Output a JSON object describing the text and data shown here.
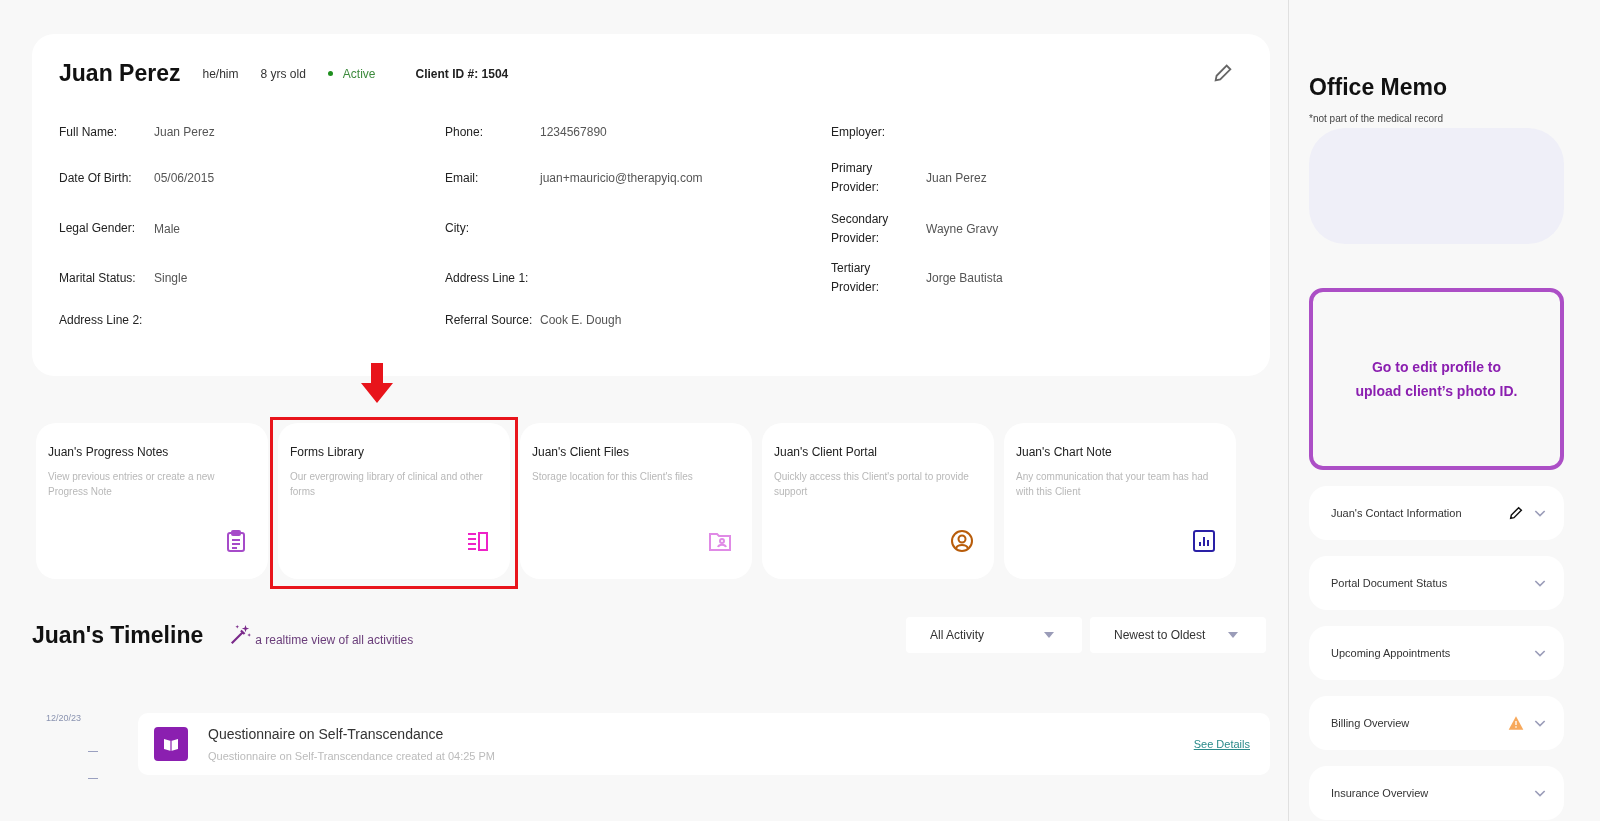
{
  "client": {
    "name": "Juan Perez",
    "pronouns": "he/him",
    "age": "8 yrs old",
    "status": "Active",
    "active": true,
    "client_id_label": "Client ID #:",
    "client_id": "1504"
  },
  "fields": [
    [
      {
        "label": "Full Name:",
        "value": "Juan Perez"
      },
      {
        "label": "Phone:",
        "value": "1234567890"
      },
      {
        "label": "Employer:"
      }
    ],
    [
      {
        "label": "Date Of Birth:",
        "value": "05/06/2015"
      },
      {
        "label": "Email:",
        "value": "juan+mauricio@therapyiq.com"
      },
      {
        "label": "Primary Provider:",
        "value": "Juan Perez"
      }
    ],
    [
      {
        "label": "Legal Gender:",
        "value": "Male"
      },
      {
        "label": "City:"
      },
      {
        "label": "Secondary Provider:",
        "value": "Wayne Gravy"
      }
    ],
    [
      {
        "label": "Marital Status:",
        "value": "Single"
      },
      {
        "label": "Address Line 1:"
      },
      {
        "label": "Tertiary Provider:",
        "value": "Jorge Bautista"
      }
    ],
    [
      {
        "label": "Address Line 2:"
      },
      {
        "label": "Referral Source:",
        "value": "Cook E. Dough"
      }
    ]
  ],
  "tiles": [
    {
      "title": "Juan's Progress Notes",
      "description": "View previous entries or create a new Progress Note",
      "kind": "clipboard",
      "highlighted": false
    },
    {
      "title": "Forms Library",
      "description": "Our evergrowing library of clinical and other forms",
      "kind": "forms",
      "highlighted": true
    },
    {
      "title": "Juan's Client Files",
      "description": "Storage location for this Client's files",
      "kind": "folder",
      "highlighted": false
    },
    {
      "title": "Juan's Client Portal",
      "description": "Quickly access this Client's portal to provide support",
      "kind": "user",
      "highlighted": false
    },
    {
      "title": "Juan's Chart Note",
      "description": "Any communication that your team has had with this Client",
      "kind": "chart",
      "highlighted": false
    }
  ],
  "timeline": {
    "title": "Juan's Timeline",
    "subtitle": "a realtime view of all activities",
    "filters": [
      "All Activity",
      "Newest to Oldest"
    ],
    "entries": [
      {
        "date": "12/20/23",
        "title": "Questionnaire on Self-Transcendance",
        "detail": "Questionnaire on Self-Transcendance created at 04:25 PM",
        "link": "See Details"
      }
    ]
  },
  "sidebar": {
    "title": "Office Memo",
    "note": "*not part of the medical record",
    "photo_prompt": "Go to edit profile to upload client’s photo ID.",
    "sections": [
      {
        "title": "Juan's Contact Information",
        "kind": "editable"
      },
      {
        "title": "Portal Document Status",
        "kind": "plain"
      },
      {
        "title": "Upcoming Appointments",
        "kind": "plain"
      },
      {
        "title": "Billing Overview",
        "kind": "alert"
      },
      {
        "title": "Insurance Overview",
        "kind": "plain"
      }
    ]
  }
}
